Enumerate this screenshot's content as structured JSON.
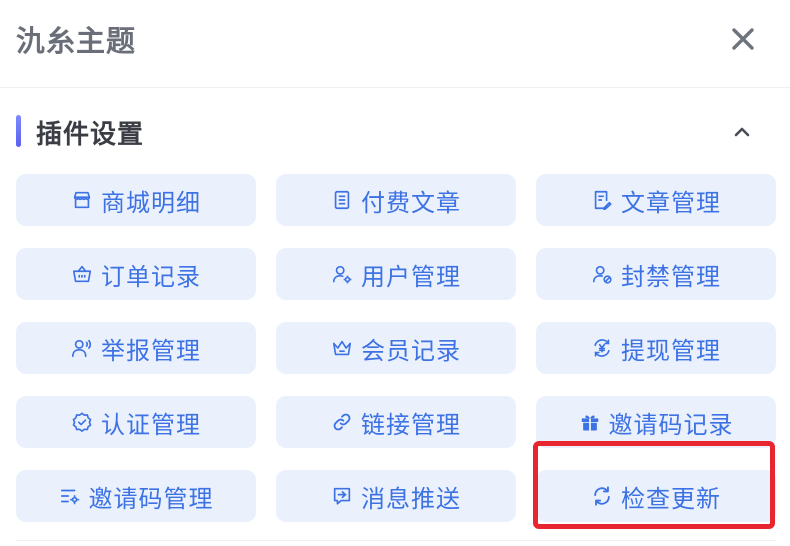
{
  "header": {
    "title": "氿糸主题",
    "close_icon": "close-icon"
  },
  "section": {
    "title": "插件设置",
    "collapse_icon": "chevron-up-icon",
    "accent_color": "#6a72f5"
  },
  "tiles": [
    {
      "label": "商城明细",
      "icon": "store-icon"
    },
    {
      "label": "付费文章",
      "icon": "document-icon"
    },
    {
      "label": "文章管理",
      "icon": "article-edit-icon"
    },
    {
      "label": "订单记录",
      "icon": "basket-icon"
    },
    {
      "label": "用户管理",
      "icon": "user-gear-icon"
    },
    {
      "label": "封禁管理",
      "icon": "user-ban-icon"
    },
    {
      "label": "举报管理",
      "icon": "user-report-icon"
    },
    {
      "label": "会员记录",
      "icon": "crown-icon"
    },
    {
      "label": "提现管理",
      "icon": "yen-cycle-icon"
    },
    {
      "label": "认证管理",
      "icon": "verified-badge-icon"
    },
    {
      "label": "链接管理",
      "icon": "link-icon"
    },
    {
      "label": "邀请码记录",
      "icon": "gift-icon"
    },
    {
      "label": "邀请码管理",
      "icon": "list-gear-icon"
    },
    {
      "label": "消息推送",
      "icon": "message-push-icon"
    },
    {
      "label": "检查更新",
      "icon": "refresh-icon"
    }
  ],
  "highlighted_tile": "检查更新",
  "colors": {
    "tile_bg": "#eaf1fd",
    "tile_text": "#3d72e4",
    "highlight_border": "#e7262f",
    "title_gray": "#6a6e78"
  }
}
